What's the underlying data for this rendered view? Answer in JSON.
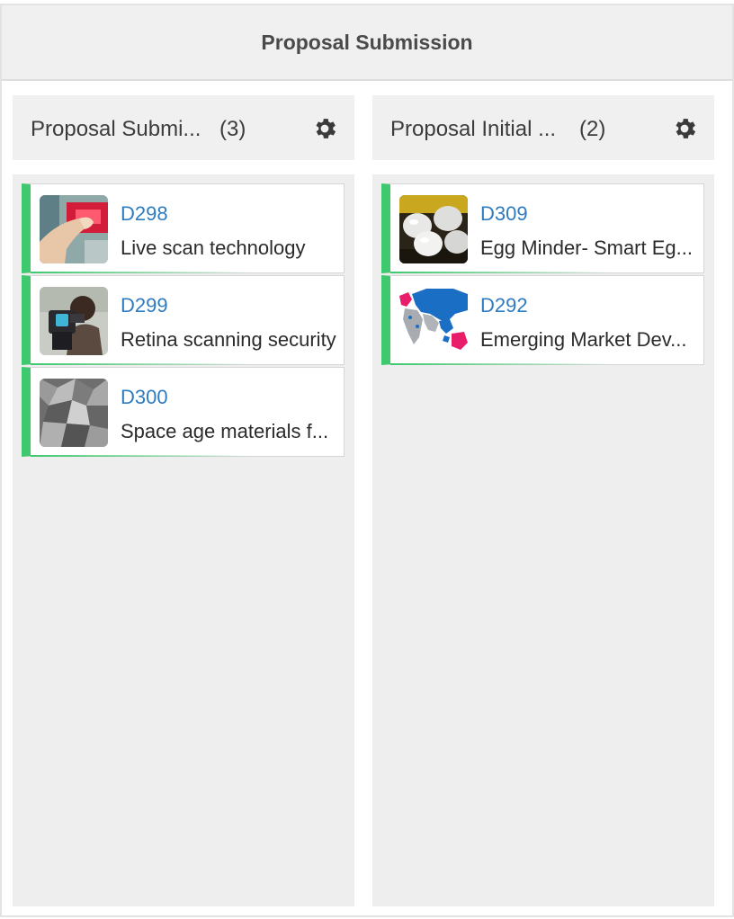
{
  "page": {
    "title": "Proposal Submission"
  },
  "columns": [
    {
      "title": "Proposal Submi...",
      "count": "(3)",
      "cards": [
        {
          "id": "D298",
          "description": "Live scan technology",
          "thumb": "fingerprint-scan-thumbnail"
        },
        {
          "id": "D299",
          "description": "Retina scanning security",
          "thumb": "retina-scan-thumbnail"
        },
        {
          "id": "D300",
          "description": "Space age materials f...",
          "thumb": "metal-geodesic-thumbnail"
        }
      ]
    },
    {
      "title": "Proposal Initial ...",
      "count": "(2)",
      "cards": [
        {
          "id": "D309",
          "description": "Egg Minder- Smart Eg...",
          "thumb": "eggs-tray-thumbnail"
        },
        {
          "id": "D292",
          "description": "Emerging Market Dev...",
          "thumb": "world-map-thumbnail"
        }
      ]
    }
  ],
  "colors": {
    "accent_green": "#3ec96e",
    "link_blue": "#2f7bbf",
    "header_bg": "#f0f0f0",
    "column_bg": "#eeeeee"
  },
  "icons": {
    "settings": "gear-icon"
  }
}
